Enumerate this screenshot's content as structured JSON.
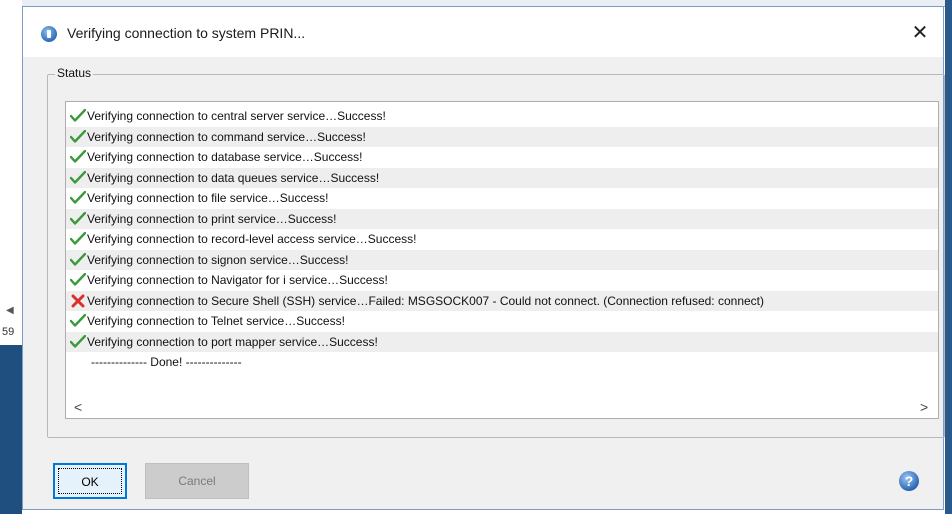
{
  "window": {
    "title": "Verifying connection to system PRIN...",
    "close_glyph": "✕"
  },
  "background": {
    "left_fragment": "59",
    "left_arrow": "◀"
  },
  "status": {
    "group_label": "Status",
    "rows": [
      {
        "result": "success",
        "text": "Verifying connection to central server service…Success!"
      },
      {
        "result": "success",
        "text": "Verifying connection to command service…Success!"
      },
      {
        "result": "success",
        "text": "Verifying connection to database service…Success!"
      },
      {
        "result": "success",
        "text": "Verifying connection to data queues service…Success!"
      },
      {
        "result": "success",
        "text": "Verifying connection to file service…Success!"
      },
      {
        "result": "success",
        "text": "Verifying connection to print service…Success!"
      },
      {
        "result": "success",
        "text": "Verifying connection to record-level access service…Success!"
      },
      {
        "result": "success",
        "text": "Verifying connection to signon service…Success!"
      },
      {
        "result": "success",
        "text": "Verifying connection to Navigator for i service…Success!"
      },
      {
        "result": "failed",
        "text": "Verifying connection to Secure Shell (SSH) service…Failed: MSGSOCK007 - Could not connect. (Connection refused: connect)"
      },
      {
        "result": "success",
        "text": "Verifying connection to Telnet service…Success!"
      },
      {
        "result": "success",
        "text": "Verifying connection to port mapper service…Success!"
      },
      {
        "result": "none",
        "text": "-------------- Done! --------------"
      }
    ],
    "scroll_left": "<",
    "scroll_right": ">"
  },
  "buttons": {
    "ok_label": "OK",
    "cancel_label": "Cancel",
    "help_glyph": "?"
  },
  "icons": {
    "success": "checkmark-icon",
    "failed": "red-x-icon",
    "title": "app-globe-icon",
    "help": "help-icon"
  },
  "colors": {
    "success": "#3a9a3a",
    "failed": "#d9302c",
    "accent": "#0078d7"
  }
}
